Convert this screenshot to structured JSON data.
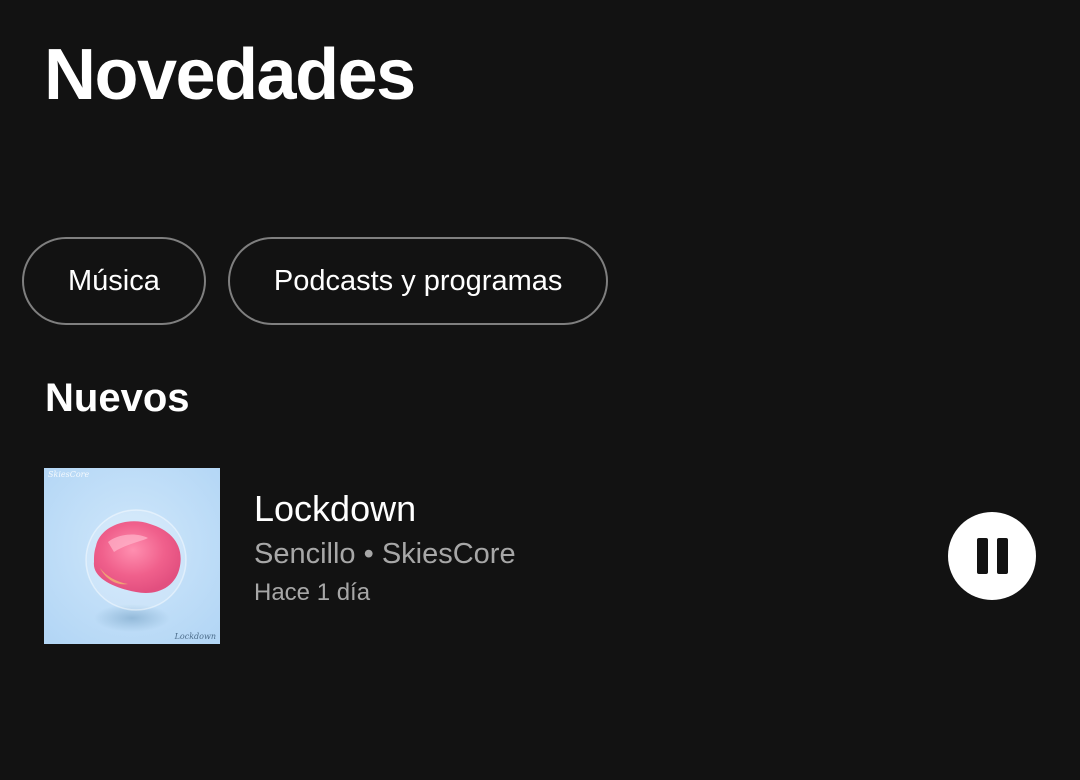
{
  "header": {
    "title": "Novedades"
  },
  "filters": [
    {
      "label": "Música"
    },
    {
      "label": "Podcasts y programas"
    }
  ],
  "section": {
    "title": "Nuevos"
  },
  "releases": [
    {
      "title": "Lockdown",
      "subtitle": "Sencillo • SkiesCore",
      "date": "Hace 1 día",
      "cover_text_top": "SkiesCore",
      "cover_text_bottom": "Lockdown",
      "is_playing": true
    }
  ],
  "icons": {
    "pause": "pause-icon"
  },
  "colors": {
    "background": "#121212",
    "text_primary": "#ffffff",
    "text_secondary": "#a7a7a7",
    "chip_border": "#7f7f7f",
    "cover_background": "#bcdcf6",
    "cover_blob": "#f06a92"
  }
}
